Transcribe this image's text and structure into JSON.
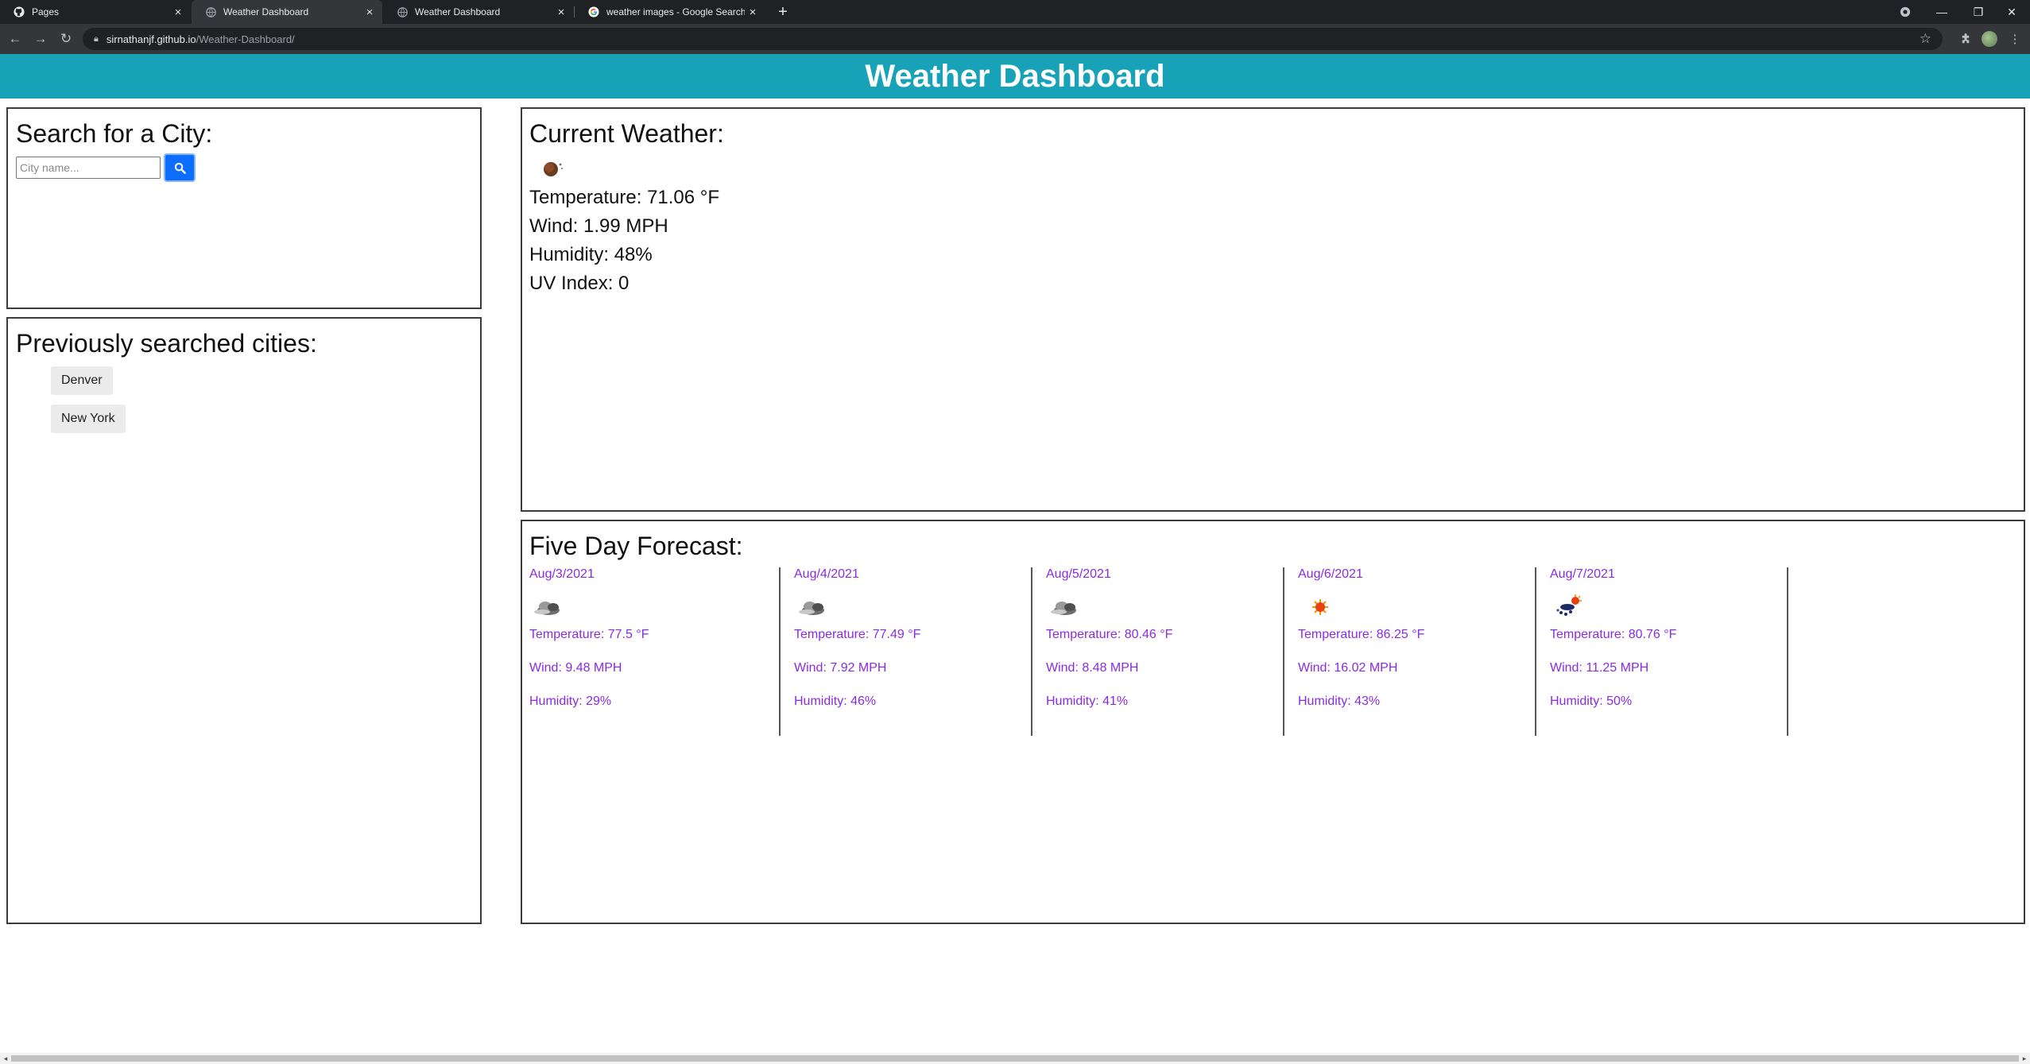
{
  "browser": {
    "tabs": [
      {
        "label": "Pages",
        "icon": "github-icon"
      },
      {
        "label": "Weather Dashboard",
        "icon": "globe-icon"
      },
      {
        "label": "Weather Dashboard",
        "icon": "globe-icon"
      },
      {
        "label": "weather images - Google Search",
        "icon": "google-icon"
      }
    ],
    "active_tab": 1,
    "url_host": "sirnathanjf.github.io",
    "url_path": "/Weather-Dashboard/"
  },
  "header": {
    "title": "Weather Dashboard"
  },
  "search": {
    "heading": "Search for a City:",
    "placeholder": "City name...",
    "value": ""
  },
  "history": {
    "heading": "Previously searched cities:",
    "cities": [
      "Denver",
      "New York"
    ]
  },
  "current": {
    "heading": "Current Weather:",
    "icon": "night-moon-icon",
    "temperature": "Temperature: 71.06 °F",
    "wind": "Wind: 1.99 MPH",
    "humidity": "Humidity: 48%",
    "uv": "UV Index: 0"
  },
  "forecast": {
    "heading": "Five Day Forecast:",
    "days": [
      {
        "date": "Aug/3/2021",
        "icon": "cloudy-icon",
        "temperature": "Temperature: 77.5 °F",
        "wind": "Wind: 9.48 MPH",
        "humidity": "Humidity: 29%"
      },
      {
        "date": "Aug/4/2021",
        "icon": "cloudy-icon",
        "temperature": "Temperature: 77.49 °F",
        "wind": "Wind: 7.92 MPH",
        "humidity": "Humidity: 46%"
      },
      {
        "date": "Aug/5/2021",
        "icon": "cloudy-icon",
        "temperature": "Temperature: 80.46 °F",
        "wind": "Wind: 8.48 MPH",
        "humidity": "Humidity: 41%"
      },
      {
        "date": "Aug/6/2021",
        "icon": "sun-icon",
        "temperature": "Temperature: 86.25 °F",
        "wind": "Wind: 16.02 MPH",
        "humidity": "Humidity: 43%"
      },
      {
        "date": "Aug/7/2021",
        "icon": "sun-rain-icon",
        "temperature": "Temperature: 80.76 °F",
        "wind": "Wind: 11.25 MPH",
        "humidity": "Humidity: 50%"
      }
    ]
  },
  "colors": {
    "header_bg": "#17a2b8",
    "search_button": "#0d6efd",
    "forecast_text": "#8a2be2"
  }
}
